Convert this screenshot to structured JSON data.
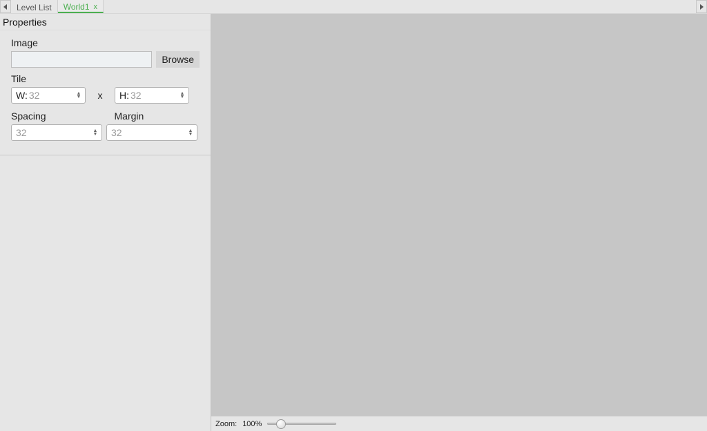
{
  "tabs": {
    "scroll_left_icon": "◀",
    "scroll_right_icon": "▶",
    "items": [
      {
        "label": "Level List",
        "active": false,
        "closable": false
      },
      {
        "label": "World1",
        "active": true,
        "closable": true,
        "close_glyph": "x"
      }
    ]
  },
  "properties": {
    "title": "Properties",
    "image": {
      "label": "Image",
      "value": "",
      "browse_label": "Browse"
    },
    "tile": {
      "label": "Tile",
      "width_prefix": "W:",
      "width_placeholder": "32",
      "sep": "x",
      "height_prefix": "H:",
      "height_placeholder": "32"
    },
    "spacing": {
      "label": "Spacing",
      "placeholder": "32"
    },
    "margin": {
      "label": "Margin",
      "placeholder": "32"
    }
  },
  "statusbar": {
    "zoom_label": "Zoom:",
    "zoom_value": "100%"
  }
}
